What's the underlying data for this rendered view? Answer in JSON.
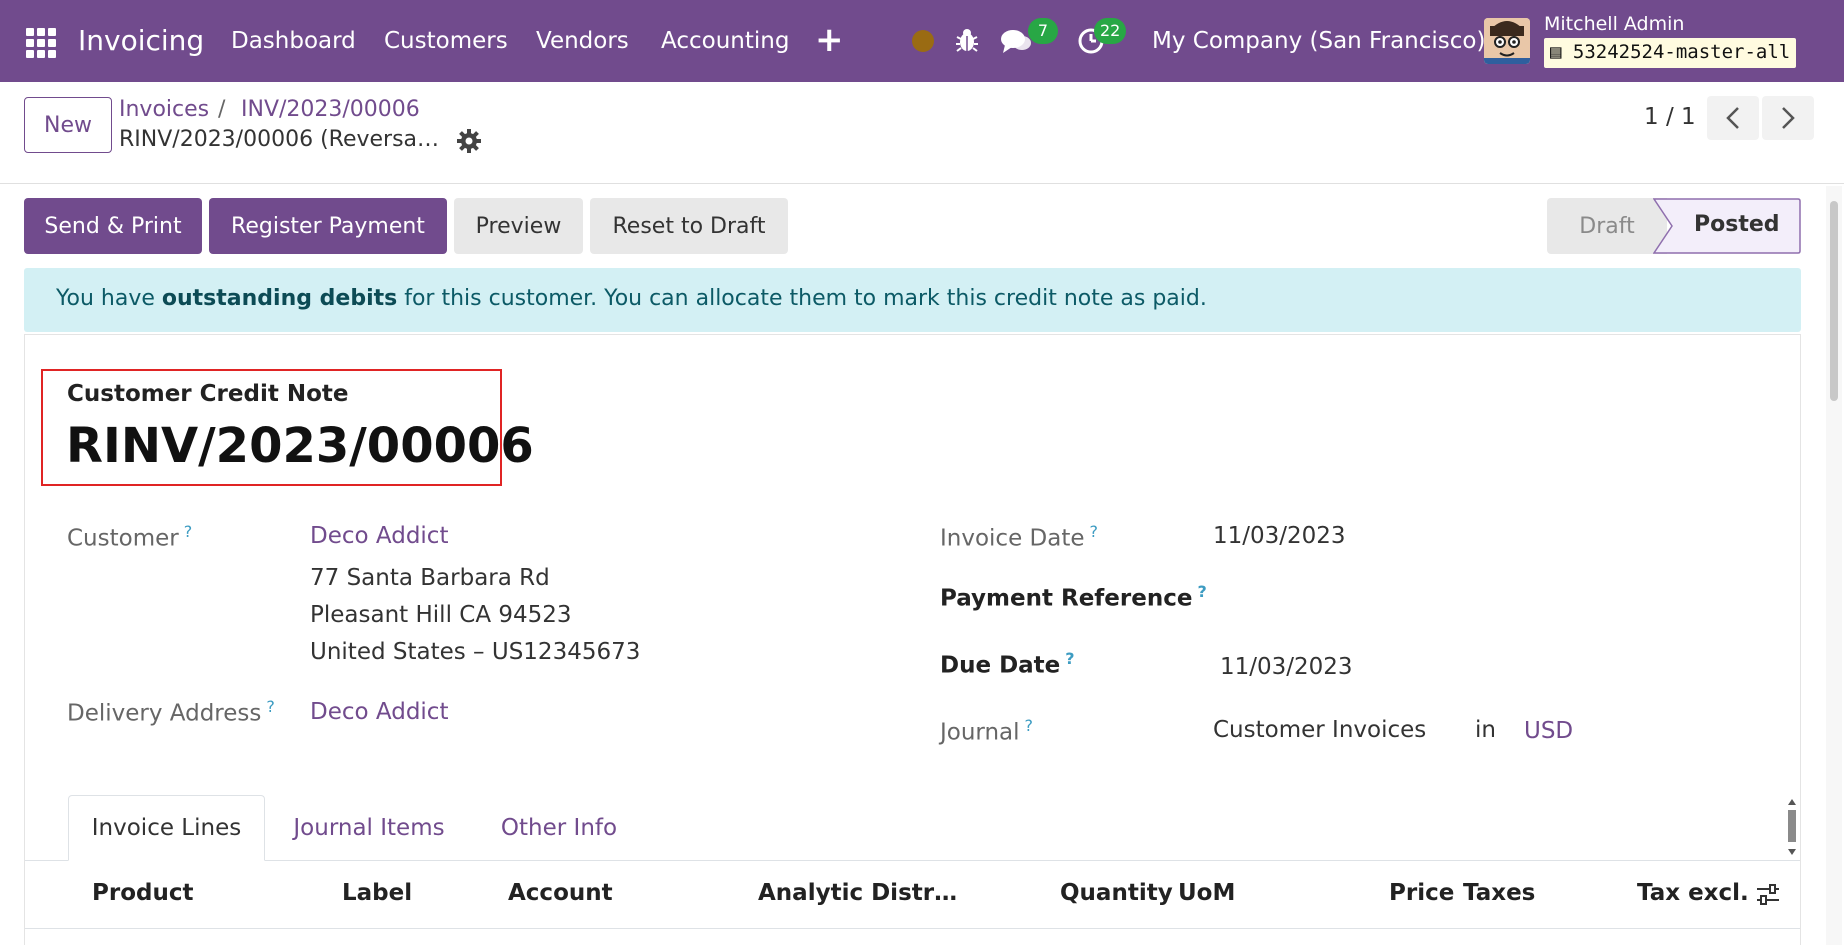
{
  "navbar": {
    "app_name": "Invoicing",
    "menu": [
      "Dashboard",
      "Customers",
      "Vendors",
      "Accounting"
    ],
    "plus_symbol": "+",
    "chat_count": "7",
    "activity_count": "22",
    "company": "My Company (San Francisco)",
    "user_name": "Mitchell Admin",
    "database": "53242524-master-all",
    "colors": {
      "bar": "#714b8d",
      "badge": "#28a745",
      "status_dot": "#9a6b13"
    }
  },
  "control_panel": {
    "new_label": "New",
    "breadcrumb": [
      "Invoices",
      "INV/2023/00006"
    ],
    "breadcrumb_sep": "/",
    "current_record": "RINV/2023/00006 (Reversa…",
    "pager": "1 / 1"
  },
  "actions": {
    "send_print": "Send & Print",
    "register_payment": "Register Payment",
    "preview": "Preview",
    "reset_to_draft": "Reset to Draft"
  },
  "status": {
    "stages": [
      "Draft",
      "Posted"
    ],
    "current": "Posted"
  },
  "alert": {
    "prefix": "You have ",
    "bold": "outstanding debits",
    "suffix": " for this customer. You can allocate them to mark this credit note as paid."
  },
  "document": {
    "type": "Customer Credit Note",
    "name": "RINV/2023/00006"
  },
  "fields": {
    "customer_label": "Customer",
    "customer_name": "Deco Addict",
    "address_lines": [
      "77 Santa Barbara Rd",
      "Pleasant Hill CA 94523",
      "United States – US12345673"
    ],
    "delivery_label": "Delivery Address",
    "delivery_value": "Deco Addict",
    "invoice_date_label": "Invoice Date",
    "invoice_date": "11/03/2023",
    "payment_ref_label": "Payment Reference",
    "due_date_label": "Due Date",
    "due_date": "11/03/2023",
    "journal_label": "Journal",
    "journal_value": "Customer Invoices",
    "journal_in": "in",
    "currency": "USD",
    "tooltip_mark": "?"
  },
  "tabs": [
    "Invoice Lines",
    "Journal Items",
    "Other Info"
  ],
  "table": {
    "headers": [
      "Product",
      "Label",
      "Account",
      "Analytic Distr…",
      "Quantity",
      "UoM",
      "Price",
      "Taxes",
      "Tax excl."
    ]
  }
}
